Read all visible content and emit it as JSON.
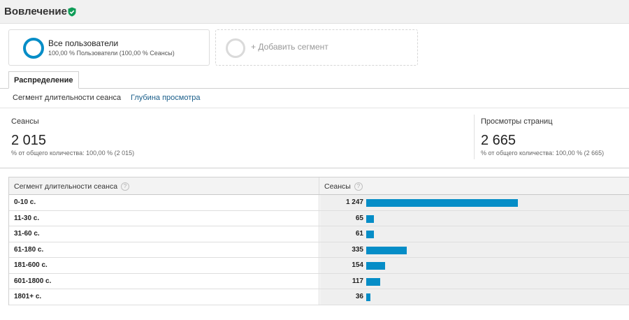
{
  "header": {
    "title": "Вовлечение",
    "verified_icon": "verified-shield-icon"
  },
  "segments": {
    "active": {
      "name": "Все пользователи",
      "sub": "100,00 % Пользователи (100,00 % Сеансы)"
    },
    "add_label": "+ Добавить сегмент"
  },
  "tabs": {
    "active": "Распределение"
  },
  "subnav": {
    "active": "Сегмент длительности сеанса",
    "link": "Глубина просмотра"
  },
  "metrics": [
    {
      "label": "Сеансы",
      "value": "2 015",
      "pct": "% от общего количества: 100,00 % (2 015)"
    },
    {
      "label": "Просмотры страниц",
      "value": "2 665",
      "pct": "% от общего количества: 100,00 % (2 665)"
    }
  ],
  "table": {
    "headers": [
      "Сегмент длительности сеанса",
      "Сеансы"
    ],
    "help_icon": "?",
    "rows": [
      {
        "name": "0-10 с.",
        "value": "1 247",
        "num": 1247
      },
      {
        "name": "11-30 с.",
        "value": "65",
        "num": 65
      },
      {
        "name": "31-60 с.",
        "value": "61",
        "num": 61
      },
      {
        "name": "61-180 с.",
        "value": "335",
        "num": 335
      },
      {
        "name": "181-600 с.",
        "value": "154",
        "num": 154
      },
      {
        "name": "601-1800 с.",
        "value": "117",
        "num": 117
      },
      {
        "name": "1801+ с.",
        "value": "36",
        "num": 36
      }
    ]
  },
  "colors": {
    "accent": "#058dc7",
    "verified": "#0f9d58",
    "link": "#1a5e8a"
  }
}
